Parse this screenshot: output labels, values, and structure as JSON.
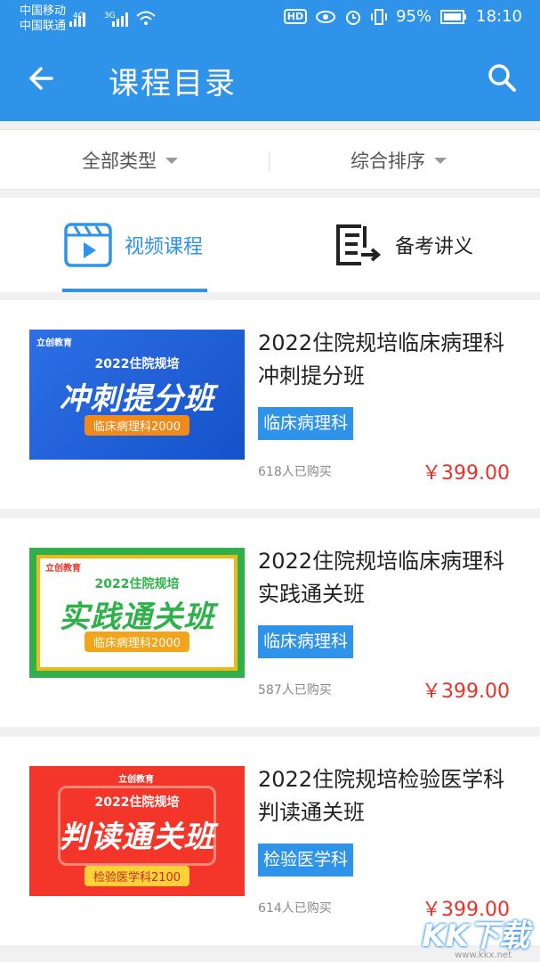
{
  "status": {
    "carrier1": "中国移动",
    "carrier2": "中国联通",
    "net1": "4G",
    "net2": "3G",
    "battery": "95%",
    "time": "18:10"
  },
  "header": {
    "title": "课程目录"
  },
  "filters": {
    "type_label": "全部类型",
    "sort_label": "综合排序"
  },
  "tabs": [
    {
      "label": "视频课程",
      "active": true,
      "color": "#2f93ea"
    },
    {
      "label": "备考讲义",
      "active": false,
      "color": "#222222"
    }
  ],
  "courses": [
    {
      "title": "2022住院规培临床病理科冲刺提分班",
      "tag": "临床病理科",
      "buyers": "618人已购买",
      "price": "￥399.00",
      "thumb": {
        "brand": "立创教育",
        "year": "2022住院规培",
        "big": "冲刺提分班",
        "chip": "临床病理科2000",
        "bg": "#1d63d9",
        "chip_bg": "#f08a1a"
      }
    },
    {
      "title": "2022住院规培临床病理科实践通关班",
      "tag": "临床病理科",
      "buyers": "587人已购买",
      "price": "￥399.00",
      "thumb": {
        "brand": "立创教育",
        "year": "2022住院规培",
        "big": "实践通关班",
        "chip": "临床病理科2000",
        "bg": "#2fb14a",
        "chip_bg": "#f2a51a"
      }
    },
    {
      "title": "2022住院规培检验医学科判读通关班",
      "tag": "检验医学科",
      "buyers": "614人已购买",
      "price": "￥399.00",
      "thumb": {
        "brand": "立创教育",
        "year": "2022住院规培",
        "big": "判读通关班",
        "chip": "检验医学科2100",
        "bg": "#f3352a",
        "chip_bg": "#ffd23a"
      }
    }
  ],
  "watermark": {
    "text": "KK下载",
    "url": "www.kkx.net"
  }
}
